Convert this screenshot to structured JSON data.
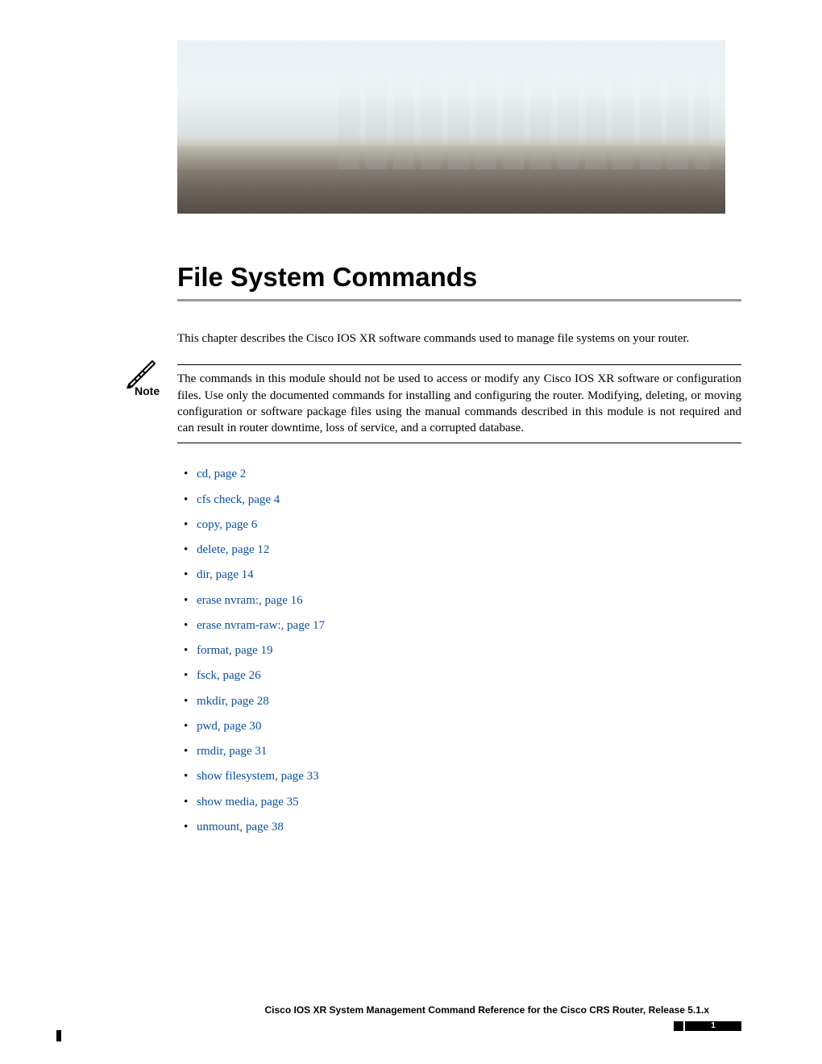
{
  "chapter_title": "File System Commands",
  "intro": "This chapter describes the Cisco IOS XR software commands used to manage file systems on your router.",
  "note": {
    "label": "Note",
    "body": "The commands in this module should not be used to access or modify any Cisco IOS XR software or configuration files. Use only the documented commands for installing and configuring the router. Modifying, deleting, or moving configuration or software package files using the manual commands described in this module is not required and can result in router downtime, loss of service, and a corrupted database."
  },
  "toc": [
    {
      "cmd": "cd,",
      "page": "page  2"
    },
    {
      "cmd": "cfs check,",
      "page": "page  4"
    },
    {
      "cmd": "copy,",
      "page": "page  6"
    },
    {
      "cmd": "delete,",
      "page": "page  12"
    },
    {
      "cmd": "dir,",
      "page": "page  14"
    },
    {
      "cmd": "erase nvram:,",
      "page": "page  16"
    },
    {
      "cmd": "erase nvram-raw:,",
      "page": "page  17"
    },
    {
      "cmd": "format,",
      "page": "page  19"
    },
    {
      "cmd": "fsck,",
      "page": "page  26"
    },
    {
      "cmd": "mkdir,",
      "page": "page  28"
    },
    {
      "cmd": "pwd,",
      "page": "page  30"
    },
    {
      "cmd": "rmdir,",
      "page": "page  31"
    },
    {
      "cmd": "show filesystem,",
      "page": "page  33"
    },
    {
      "cmd": "show media,",
      "page": "page  35"
    },
    {
      "cmd": "unmount,",
      "page": "page  38"
    }
  ],
  "footer": {
    "title": "Cisco IOS XR System Management Command Reference for the Cisco CRS Router, Release 5.1.x",
    "pagenum": "1"
  }
}
